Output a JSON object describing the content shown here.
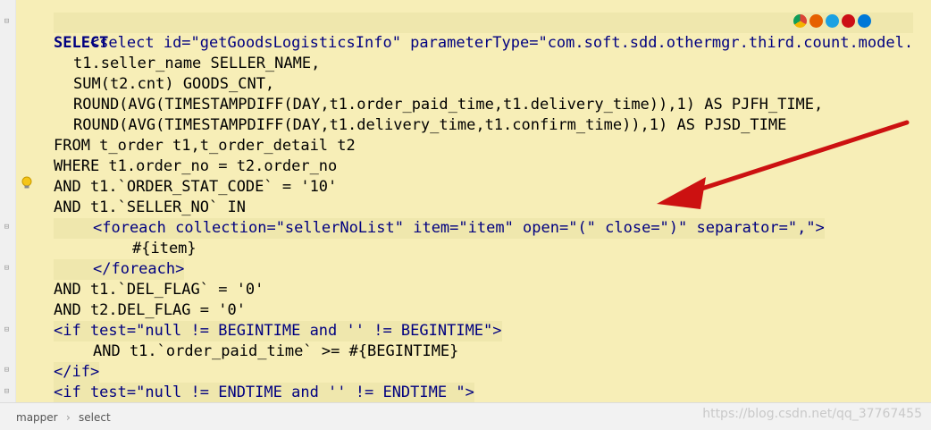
{
  "code_lines": [
    "<select id=\"getGoodsLogisticsInfo\" parameterType=\"com.soft.sdd.othermgr.third.count.model.",
    "SELECT",
    "t1.seller_name SELLER_NAME,",
    "SUM(t2.cnt) GOODS_CNT,",
    "ROUND(AVG(TIMESTAMPDIFF(DAY,t1.order_paid_time,t1.delivery_time)),1) AS PJFH_TIME,",
    "ROUND(AVG(TIMESTAMPDIFF(DAY,t1.delivery_time,t1.confirm_time)),1) AS PJSD_TIME",
    "FROM t_order t1,t_order_detail t2",
    "WHERE t1.order_no = t2.order_no",
    "AND t1.`ORDER_STAT_CODE` = '10'",
    "AND t1.`SELLER_NO` IN",
    "<foreach collection=\"sellerNoList\" item=\"item\" open=\"(\" close=\")\" separator=\",\">",
    "#{item}",
    "</foreach>",
    "AND t1.`DEL_FLAG` = '0'",
    "AND t2.DEL_FLAG = '0'",
    "<if test=\"null != BEGINTIME and '' != BEGINTIME\">",
    "AND t1.`order_paid_time` >= #{BEGINTIME}",
    "</if>",
    "<if test=\"null != ENDTIME and '' != ENDTIME \">"
  ],
  "breadcrumb": {
    "item1": "mapper",
    "separator": "›",
    "item2": "select"
  },
  "watermark": "https://blog.csdn.net/qq_37767455",
  "colors": {
    "editor_bg": "#f7eeb7",
    "arrow": "#cc1111",
    "tag": "#000080",
    "string": "#008000",
    "attribute": "#0000ff"
  },
  "icons": [
    "fold-marker-icon",
    "lightbulb-icon",
    "chrome-icon",
    "firefox-icon",
    "ie-icon",
    "opera-icon",
    "edge-icon"
  ]
}
